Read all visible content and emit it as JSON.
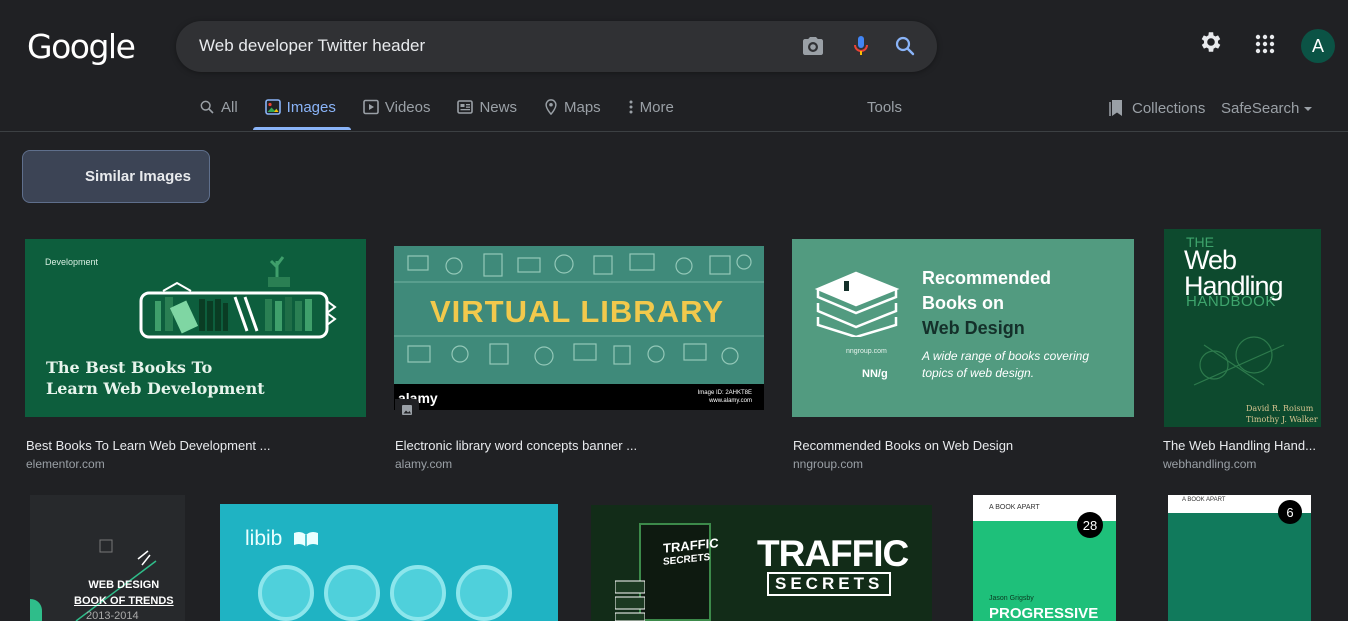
{
  "header": {
    "logo": "Google",
    "search_query": "Web developer Twitter header",
    "avatar_initial": "A"
  },
  "tabs": [
    {
      "label": "All",
      "icon": "search-icon"
    },
    {
      "label": "Images",
      "icon": "image-icon",
      "active": true
    },
    {
      "label": "Videos",
      "icon": "play-icon"
    },
    {
      "label": "News",
      "icon": "newspaper-icon"
    },
    {
      "label": "Maps",
      "icon": "map-pin-icon"
    },
    {
      "label": "More",
      "icon": "more-vert-icon"
    }
  ],
  "toolbar": {
    "tools": "Tools",
    "collections": "Collections",
    "safesearch": "SafeSearch"
  },
  "similar_images": "Similar Images",
  "results": [
    {
      "title": "Best Books To Learn Web Development ...",
      "source": "elementor.com",
      "thumb_texts": {
        "tag": "Development",
        "line1": "The Best Books To",
        "line2": "Learn Web Development"
      }
    },
    {
      "title": "Electronic library word concepts banner ...",
      "source": "alamy.com",
      "thumb_texts": {
        "headline": "VIRTUAL LIBRARY",
        "watermark": "alamy",
        "image_id": "Image ID: 2AHKT8E",
        "url": "www.alamy.com"
      }
    },
    {
      "title": "Recommended Books on Web Design",
      "source": "nngroup.com",
      "thumb_texts": {
        "l1": "Recommended",
        "l2": "Books on",
        "l3": "Web Design",
        "sub1": "A wide range of books covering",
        "sub2": "topics of web design.",
        "site": "nngroup.com",
        "brand": "NN/g"
      }
    },
    {
      "title": "The Web Handling Hand...",
      "source": "webhandling.com",
      "thumb_texts": {
        "the": "THE",
        "web": "Web",
        "handling": "Handling",
        "handbook": "HANDBOOK",
        "a1": "David R. Roisum",
        "a2": "Timothy J. Walker"
      }
    }
  ],
  "row2": {
    "r1": {
      "l1": "WEB DESIGN",
      "l2": "BOOK OF TRENDS",
      "year": "2013-2014"
    },
    "r2": {
      "logo": "libib"
    },
    "r3": {
      "title": "TRAFFIC",
      "subtitle": "SECRETS",
      "book1": "TRAFFIC",
      "book2": "SECRETS"
    },
    "r4": {
      "publisher": "A BOOK APART",
      "number": "28",
      "author": "Jason Grigsby",
      "title": "PROGRESSIVE"
    },
    "r5": {
      "publisher": "A BOOK APART",
      "number": "6"
    }
  },
  "colors": {
    "accent": "#8ab4f8",
    "bg": "#202124"
  }
}
